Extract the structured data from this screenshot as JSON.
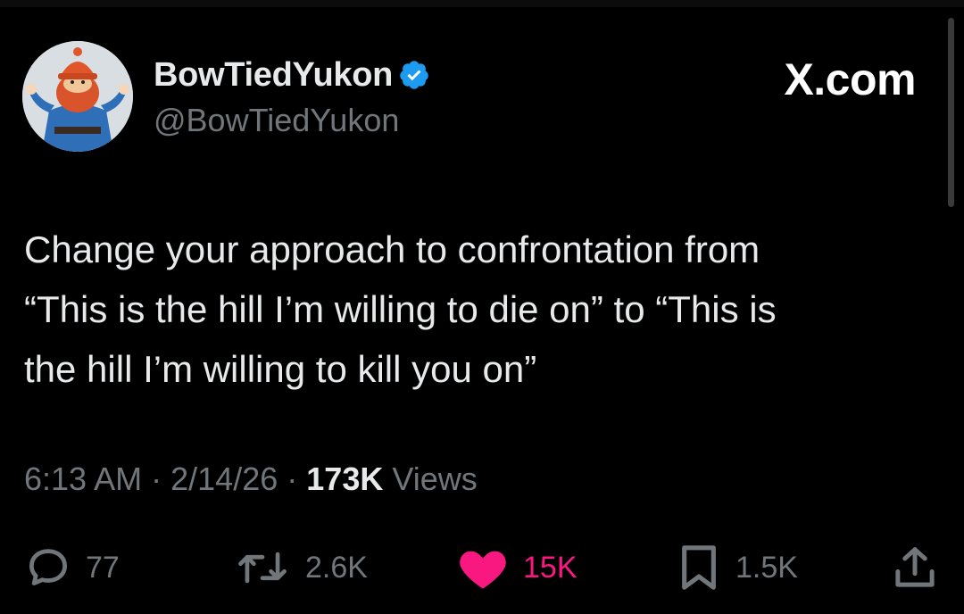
{
  "brand": "X.com",
  "author": {
    "display_name": "BowTiedYukon",
    "handle": "@BowTiedYukon",
    "verified": true,
    "verified_color": "#1d9bf0"
  },
  "tweet": {
    "lines": [
      "Change your approach to confrontation from",
      "“This is the hill I’m willing to die on” to “This is",
      "the hill I’m willing to kill you on”"
    ]
  },
  "meta": {
    "time": "6:13 AM",
    "sep1": "·",
    "date": "2/14/26",
    "sep2": "·",
    "views_count": "173K",
    "views_label": "Views"
  },
  "actions": {
    "reply": {
      "icon": "reply-icon",
      "count": "77"
    },
    "repost": {
      "icon": "repost-icon",
      "count": "2.6K"
    },
    "like": {
      "icon": "heart-icon",
      "count": "15K",
      "liked": true,
      "color": "#f91880"
    },
    "bookmark": {
      "icon": "bookmark-icon",
      "count": "1.5K"
    },
    "share": {
      "icon": "share-icon"
    }
  }
}
